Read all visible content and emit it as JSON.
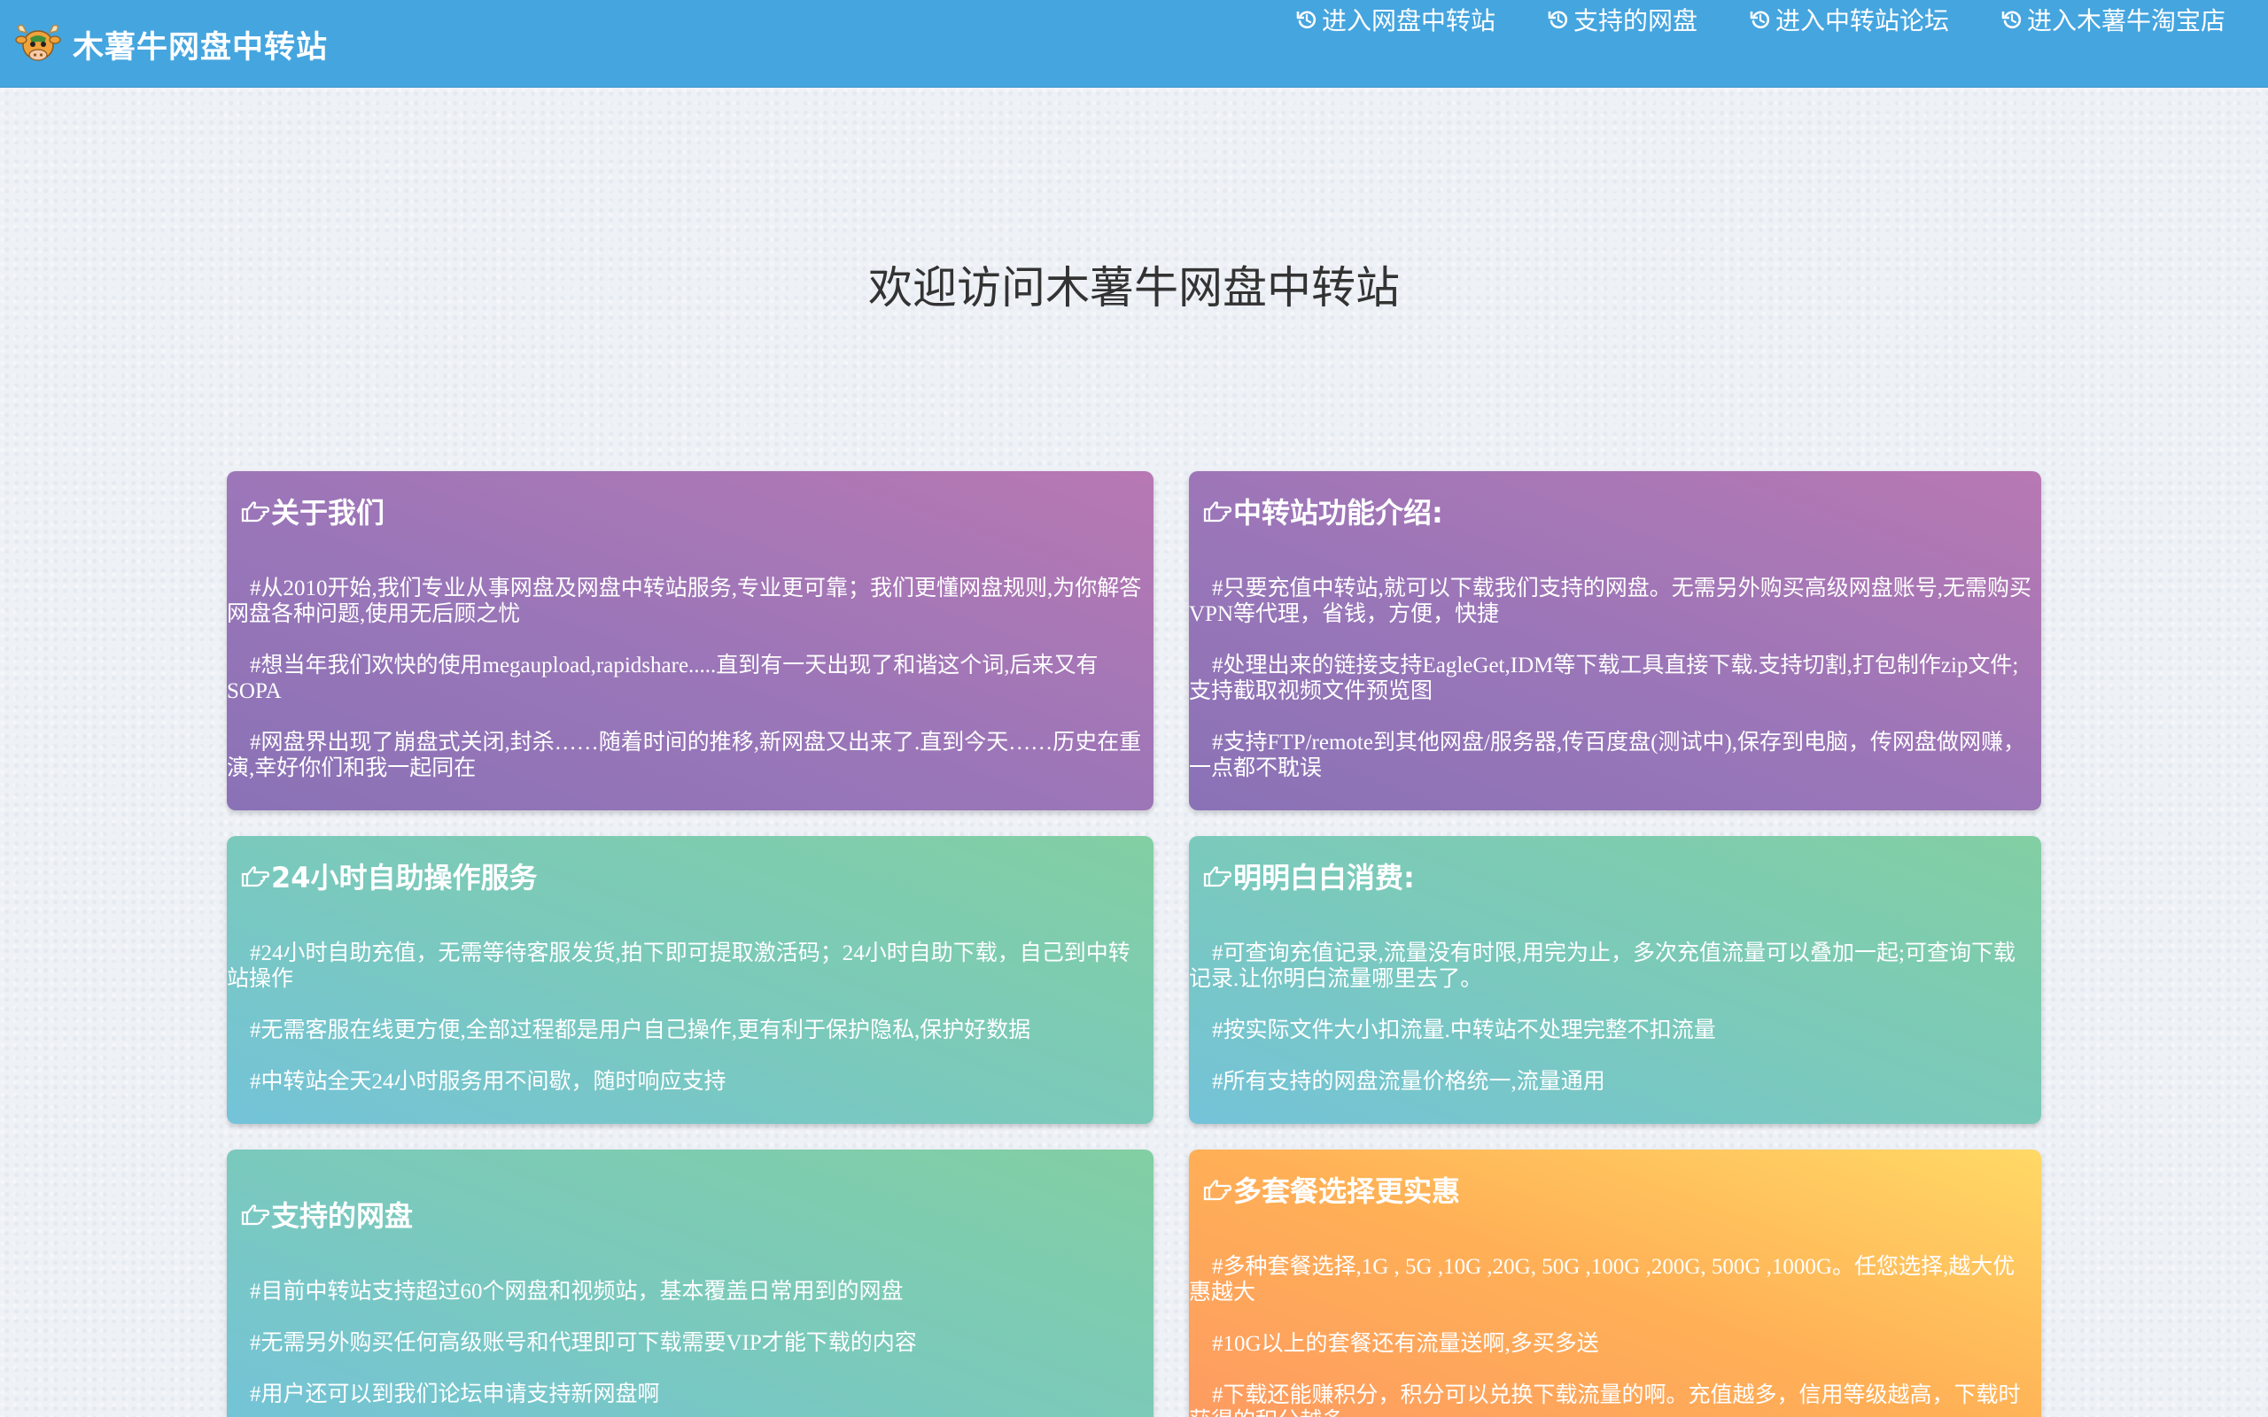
{
  "header": {
    "brand_title": "木薯牛网盘中转站",
    "nav": [
      {
        "label": "进入网盘中转站",
        "icon": "refresh-icon"
      },
      {
        "label": "支持的网盘",
        "icon": "refresh-icon"
      },
      {
        "label": "进入中转站论坛",
        "icon": "refresh-icon"
      },
      {
        "label": "进入木薯牛淘宝店",
        "icon": "refresh-icon"
      }
    ]
  },
  "welcome": "欢迎访问木薯牛网盘中转站",
  "cards": {
    "about": {
      "title": "关于我们",
      "paragraphs": [
        "#从2010开始,我们专业从事网盘及网盘中转站服务,专业更可靠；我们更懂网盘规则,为你解答网盘各种问题,使用无后顾之忧",
        "#想当年我们欢快的使用megaupload,rapidshare.....直到有一天出现了和谐这个词,后来又有SOPA",
        "#网盘界出现了崩盘式关闭,封杀……随着时间的推移,新网盘又出来了.直到今天……历史在重演,幸好你们和我一起同在"
      ]
    },
    "features": {
      "title": "中转站功能介绍:",
      "paragraphs": [
        "#只要充值中转站,就可以下载我们支持的网盘。无需另外购买高级网盘账号,无需购买VPN等代理，省钱，方便，快捷",
        "#处理出来的链接支持EagleGet,IDM等下载工具直接下载.支持切割,打包制作zip文件;支持截取视频文件预览图",
        "#支持FTP/remote到其他网盘/服务器,传百度盘(测试中),保存到电脑，传网盘做网赚，一点都不耽误"
      ]
    },
    "self_service": {
      "title": "24小时自助操作服务",
      "paragraphs": [
        "#24小时自助充值，无需等待客服发货,拍下即可提取激活码；24小时自助下载，自己到中转站操作",
        "#无需客服在线更方便,全部过程都是用户自己操作,更有利于保护隐私,保护好数据",
        "#中转站全天24小时服务用不间歇，随时响应支持"
      ]
    },
    "transparent": {
      "title": "明明白白消费:",
      "paragraphs": [
        "#可查询充值记录,流量没有时限,用完为止，多次充值流量可以叠加一起;可查询下载记录.让你明白流量哪里去了。",
        "#按实际文件大小扣流量.中转站不处理完整不扣流量",
        "#所有支持的网盘流量价格统一,流量通用"
      ]
    },
    "supported": {
      "title": "支持的网盘",
      "paragraphs": [
        "#目前中转站支持超过60个网盘和视频站，基本覆盖日常用到的网盘",
        "#无需另外购买任何高级账号和代理即可下载需要VIP才能下载的内容",
        "#用户还可以到我们论坛申请支持新网盘啊"
      ]
    },
    "packages": {
      "title": "多套餐选择更实惠",
      "paragraphs": [
        "#多种套餐选择,1G , 5G ,10G ,20G, 50G ,100G ,200G, 500G ,1000G。任您选择,越大优惠越大",
        "#10G以上的套餐还有流量送啊,多买多送",
        "#下载还能赚积分，积分可以兑换下载流量的啊。充值越多，信用等级越高，下载时获得的积分越多"
      ]
    }
  },
  "colors": {
    "header_bg": "#45a5df",
    "card_purple": "#9a76b8",
    "card_teal": "#7ac9bd",
    "card_orange": "#ffb056"
  }
}
